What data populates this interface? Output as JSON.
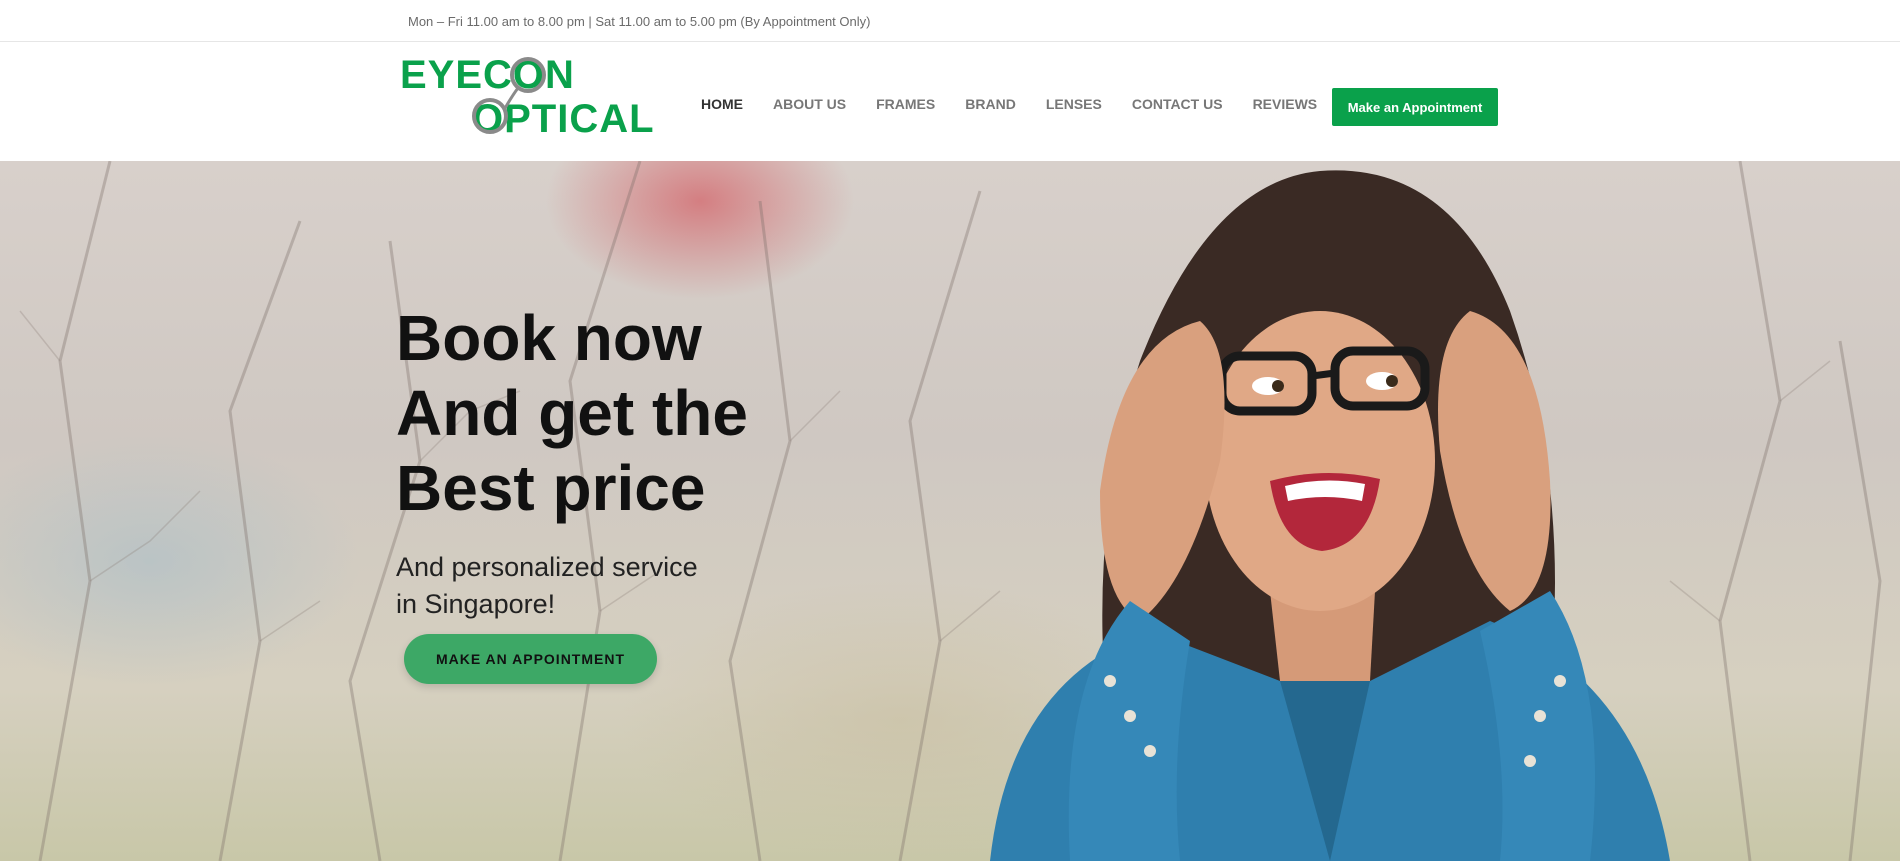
{
  "topbar": {
    "hours": "Mon – Fri 11.00 am to 8.00 pm | Sat 11.00 am to 5.00 pm (By Appointment Only)"
  },
  "header": {
    "logo": {
      "line1": "EYECON",
      "line2": "OPTICAL",
      "icon": "glasses-logo-icon",
      "color": "#0aa14b"
    },
    "nav": [
      {
        "label": "HOME",
        "active": true
      },
      {
        "label": "ABOUT US"
      },
      {
        "label": "FRAMES"
      },
      {
        "label": "BRAND"
      },
      {
        "label": "LENSES"
      },
      {
        "label": "CONTACT US"
      },
      {
        "label": "REVIEWS"
      }
    ],
    "cta_label": "Make an Appointment"
  },
  "hero": {
    "headline": [
      "Book now",
      "And get the",
      "Best price"
    ],
    "subline": [
      "And personalized service",
      "in Singapore!"
    ],
    "cta_label": "MAKE AN APPOINTMENT",
    "image": "woman-with-glasses-photo"
  },
  "colors": {
    "accent": "#0aa14b",
    "hero_button": "#3da866",
    "nav_text": "#777777",
    "nav_active": "#333333"
  }
}
